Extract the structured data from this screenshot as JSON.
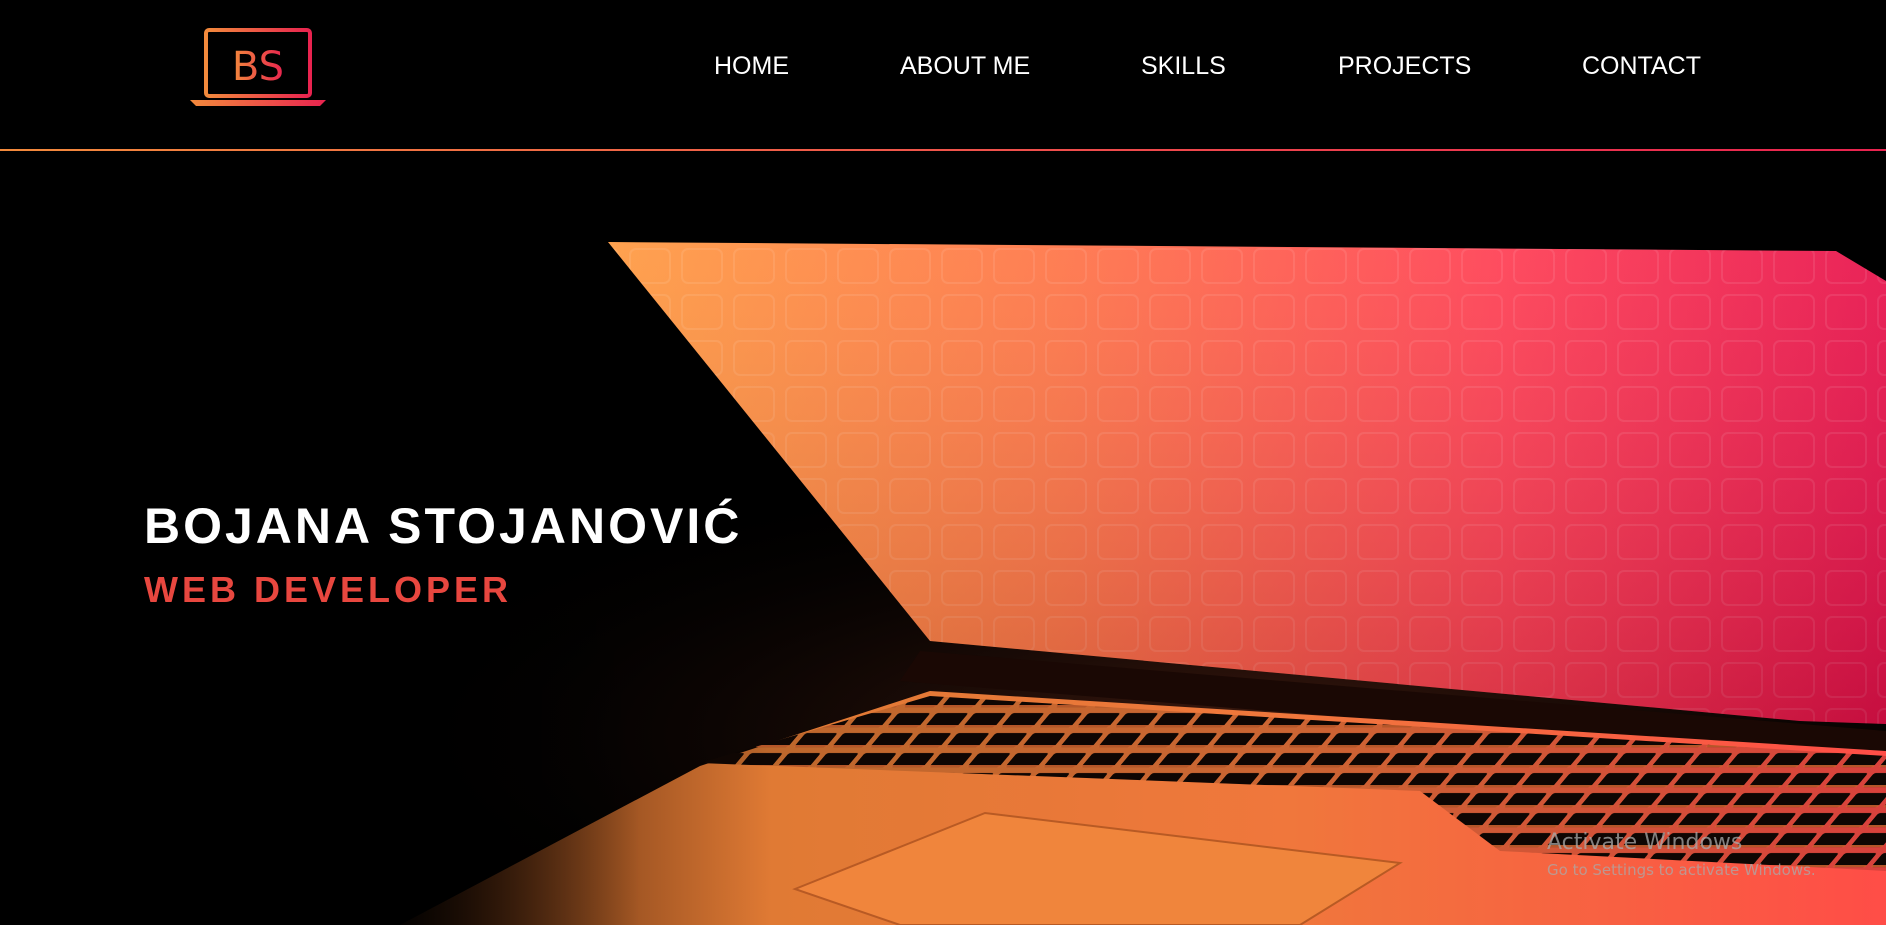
{
  "logo": {
    "text": "BS",
    "icon": "laptop-logo-icon"
  },
  "nav": {
    "items": [
      {
        "label": "HOME"
      },
      {
        "label": "ABOUT ME"
      },
      {
        "label": "SKILLS"
      },
      {
        "label": "PROJECTS"
      },
      {
        "label": "CONTACT"
      }
    ]
  },
  "hero": {
    "name": "BOJANA STOJANOVIĆ",
    "role": "WEB DEVELOPER",
    "background_image": "laptop-glowing-screen-photo"
  },
  "watermark": {
    "title": "Activate Windows",
    "subtitle": "Go to Settings to activate Windows."
  },
  "colors": {
    "accent_orange": "#f28a3c",
    "accent_red": "#e8234f",
    "role_text": "#e8473f",
    "background": "#000000",
    "nav_text": "#ffffff"
  }
}
